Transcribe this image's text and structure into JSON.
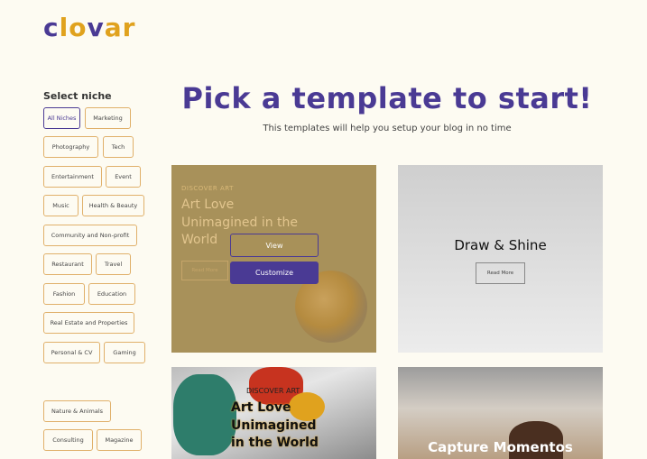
{
  "logo": {
    "part1": "c",
    "part2": "lo",
    "part3": "v",
    "part4": "ar"
  },
  "sidebar": {
    "title": "Select niche",
    "chips": [
      "All Niches",
      "Marketing",
      "Photography",
      "Tech",
      "Entertainment",
      "Event",
      "Music",
      "Health & Beauty",
      "Community and Non-profit",
      "Restaurant",
      "Travel",
      "Fashion",
      "Education",
      "Real Estate and Properties",
      "Personal & CV",
      "Gaming",
      "Nature & Animals",
      "Consulting",
      "Magazine"
    ]
  },
  "header": {
    "title": "Pick a template to start!",
    "subtitle": "This templates will help you setup your blog in no time"
  },
  "cards": {
    "art": {
      "kicker": "DISCOVER ART",
      "title": "Art Love Unimagined in the World",
      "read_more": "Read More",
      "view": "View",
      "customize": "Customize"
    },
    "draw": {
      "title": "Draw & Shine",
      "read_more": "Read More"
    },
    "art2": {
      "kicker": "DISCOVER ART",
      "title": "Art Love Unimagined in the World"
    },
    "capture": {
      "title": "Capture Momentos"
    }
  },
  "colors": {
    "brand_purple": "#4a3a94",
    "brand_orange": "#e0a21e",
    "background": "#fdfbf2"
  }
}
